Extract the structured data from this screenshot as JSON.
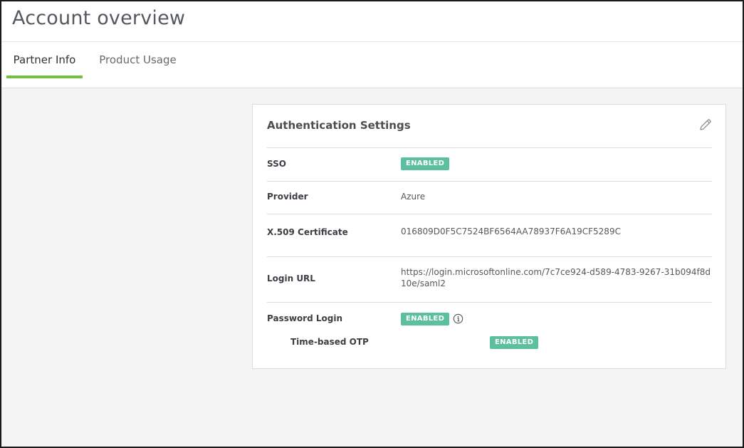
{
  "header": {
    "title": "Account overview"
  },
  "tabs": [
    {
      "label": "Partner Info",
      "active": true
    },
    {
      "label": "Product Usage",
      "active": false
    }
  ],
  "card": {
    "title": "Authentication Settings",
    "edit_icon": "pencil-icon",
    "rows": {
      "sso": {
        "label": "SSO",
        "badge": "ENABLED"
      },
      "provider": {
        "label": "Provider",
        "value": "Azure"
      },
      "certificate": {
        "label": "X.509 Certificate",
        "value": "016809D0F5C7524BF6564AA78937F6A19CF5289C"
      },
      "login_url": {
        "label": "Login URL",
        "value": "https://login.microsoftonline.com/7c7ce924-d589-4783-9267-31b094f8d10e/saml2"
      },
      "password_login": {
        "label": "Password Login",
        "badge": "ENABLED",
        "info_icon": "info-icon"
      },
      "otp": {
        "label": "Time-based OTP",
        "badge": "ENABLED"
      }
    }
  },
  "colors": {
    "accent": "#74c043",
    "badge": "#5cc0a0"
  }
}
